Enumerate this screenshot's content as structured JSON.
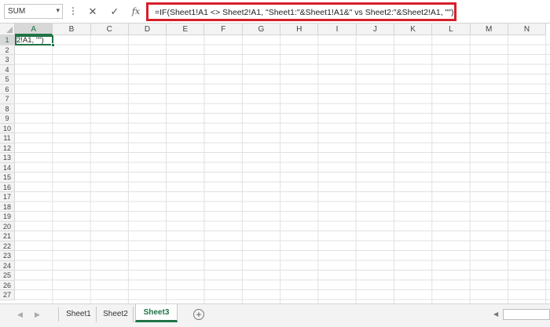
{
  "formula_bar": {
    "name_box": "SUM",
    "cancel_icon": "✕",
    "confirm_icon": "✓",
    "fx_label": "fx",
    "formula": "=IF(Sheet1!A1 <> Sheet2!A1, \"Sheet1:\"&Sheet1!A1&\" vs Sheet2:\"&Sheet2!A1, \"\")"
  },
  "grid": {
    "columns": [
      "A",
      "B",
      "C",
      "D",
      "E",
      "F",
      "G",
      "H",
      "I",
      "J",
      "K",
      "L",
      "M",
      "N"
    ],
    "rows": [
      "1",
      "2",
      "3",
      "4",
      "5",
      "6",
      "7",
      "8",
      "9",
      "10",
      "11",
      "12",
      "13",
      "14",
      "15",
      "16",
      "17",
      "18",
      "19",
      "20",
      "21",
      "22",
      "23",
      "24",
      "25",
      "26",
      "27"
    ],
    "active_cell": "A1",
    "active_cell_text": "2!A1, \"\")"
  },
  "sheet_tabs": {
    "tabs": [
      "Sheet1",
      "Sheet2",
      "Sheet3"
    ],
    "active": "Sheet3",
    "add_icon": "+"
  },
  "colors": {
    "accent": "#217346",
    "highlight_border": "#d6202a"
  }
}
